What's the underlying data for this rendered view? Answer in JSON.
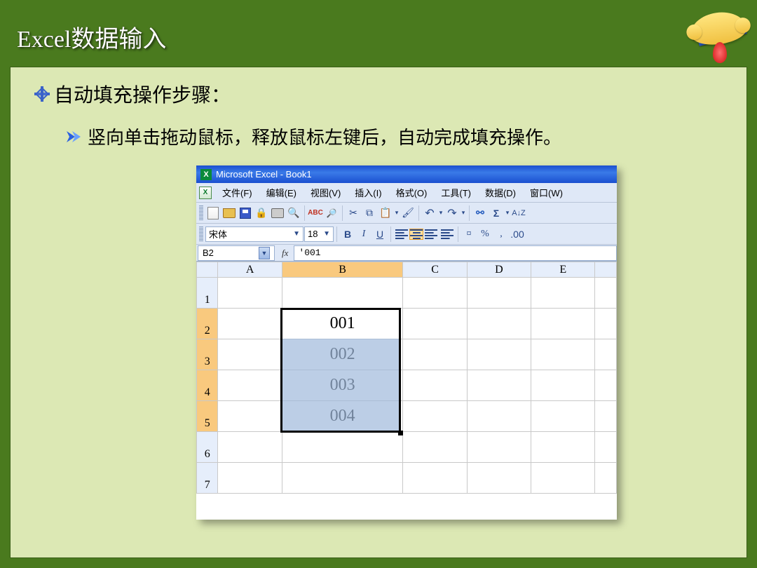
{
  "slide": {
    "title": "Excel数据输入",
    "heading": "自动填充操作步骤：",
    "body": "竖向单击拖动鼠标，释放鼠标左键后，自动完成填充操作。"
  },
  "excel": {
    "window_title": "Microsoft Excel - Book1",
    "menu": [
      "文件(F)",
      "编辑(E)",
      "视图(V)",
      "插入(I)",
      "格式(O)",
      "工具(T)",
      "数据(D)",
      "窗口(W)"
    ],
    "font_name": "宋体",
    "font_size": "18",
    "name_box": "B2",
    "formula": "'001",
    "columns": [
      "A",
      "B",
      "C",
      "D",
      "E"
    ],
    "rows": [
      "1",
      "2",
      "3",
      "4",
      "5",
      "6",
      "7"
    ],
    "cells": {
      "A": [
        "",
        "",
        "",
        "",
        "",
        "",
        ""
      ],
      "B": [
        "",
        "001",
        "002",
        "003",
        "004",
        "",
        ""
      ],
      "C": [
        "",
        "",
        "",
        "",
        "",
        "",
        ""
      ],
      "D": [
        "",
        "",
        "",
        "",
        "",
        "",
        ""
      ],
      "E": [
        "",
        "",
        "",
        "",
        "",
        "",
        ""
      ]
    },
    "selected_column": "B",
    "selected_rows": [
      "2",
      "3",
      "4",
      "5"
    ],
    "active_cell": "B2"
  },
  "tool_icons": {
    "sigma": "Σ",
    "undo": "↶",
    "redo": "↷",
    "link": "⚯",
    "sort": "A↓Z",
    "abc": "ABC",
    "cut": "✂",
    "copy": "⧉",
    "paste": "📋",
    "fpaint": "🖌",
    "research": "🔎",
    "preview": "🔍",
    "perm": "🔒",
    "currency": "¤",
    "percent": "%",
    "comma": ",",
    "dec": ".00"
  }
}
